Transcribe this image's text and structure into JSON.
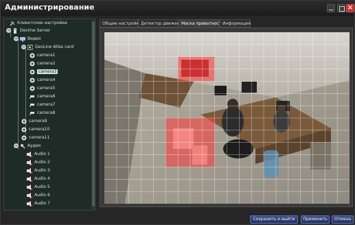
{
  "window": {
    "title": "Администрирование"
  },
  "tree": {
    "items": [
      {
        "label": "Клиентские настройки",
        "icon": "tools-icon"
      },
      {
        "label": "Devline Server",
        "icon": "server-icon",
        "expander": "−"
      },
      {
        "label": "Видео",
        "icon": "monitor-icon",
        "expander": "−"
      },
      {
        "label": "DevLine Atlas card",
        "icon": "card-icon",
        "expander": "−"
      },
      {
        "label": "camera1",
        "icon": "camera-icon"
      },
      {
        "label": "camera2",
        "icon": "camera-icon"
      },
      {
        "label": "camera3",
        "icon": "camera-icon",
        "selected": true
      },
      {
        "label": "camera4",
        "icon": "camera-icon"
      },
      {
        "label": "camera5",
        "icon": "camera-icon"
      },
      {
        "label": "camera6",
        "icon": "cctv-icon"
      },
      {
        "label": "camera7",
        "icon": "cctv-icon"
      },
      {
        "label": "camera8",
        "icon": "cctv-icon"
      },
      {
        "label": "camera9",
        "icon": "camera-icon"
      },
      {
        "label": "camera10",
        "icon": "camera-icon"
      },
      {
        "label": "camera11",
        "icon": "camera-icon"
      },
      {
        "label": "Аудио",
        "icon": "microphone-icon",
        "expander": "−"
      },
      {
        "label": "Audio 1",
        "icon": "speaker-icon"
      },
      {
        "label": "Audio 2",
        "icon": "speaker-icon"
      },
      {
        "label": "Audio 3",
        "icon": "speaker-icon"
      },
      {
        "label": "Audio 4",
        "icon": "speaker-icon"
      },
      {
        "label": "Audio 5",
        "icon": "speaker-icon"
      },
      {
        "label": "Audio 6",
        "icon": "speaker-icon"
      },
      {
        "label": "Audio 7",
        "icon": "speaker-icon"
      }
    ]
  },
  "tabs": [
    {
      "label": "Общие настройки"
    },
    {
      "label": "Детектор движения"
    },
    {
      "label": "Маска приватности",
      "active": true
    },
    {
      "label": "Информация"
    }
  ],
  "mask": {
    "grid_cols": 20,
    "grid_rows": 14,
    "color": "#ff3b3b"
  },
  "buttons": {
    "save_exit": "Сохранить и выйти",
    "apply": "Применить",
    "cancel": "Отмена"
  },
  "colors": {
    "accent": "#2f4580",
    "close": "#c9302c",
    "tree_bg": "#1e2b27"
  }
}
